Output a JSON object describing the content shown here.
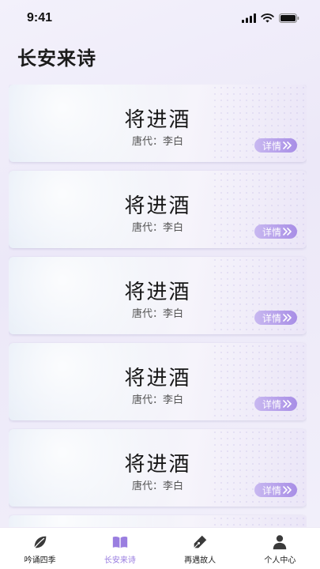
{
  "status": {
    "time": "9:41"
  },
  "header": {
    "title": "长安来诗"
  },
  "poems": [
    {
      "title": "将进酒",
      "author": "唐代：李白",
      "detail": "详情"
    },
    {
      "title": "将进酒",
      "author": "唐代：李白",
      "detail": "详情"
    },
    {
      "title": "将进酒",
      "author": "唐代：李白",
      "detail": "详情"
    },
    {
      "title": "将进酒",
      "author": "唐代：李白",
      "detail": "详情"
    },
    {
      "title": "将进酒",
      "author": "唐代：李白",
      "detail": "详情"
    }
  ],
  "tabs": [
    {
      "label": "吟诵四季",
      "icon": "leaf-icon"
    },
    {
      "label": "长安来诗",
      "icon": "book-icon",
      "active": true
    },
    {
      "label": "再遇故人",
      "icon": "pen-icon"
    },
    {
      "label": "个人中心",
      "icon": "user-icon"
    }
  ],
  "colors": {
    "accent": "#9a7ee0",
    "detail_button": "#a88ee6"
  }
}
